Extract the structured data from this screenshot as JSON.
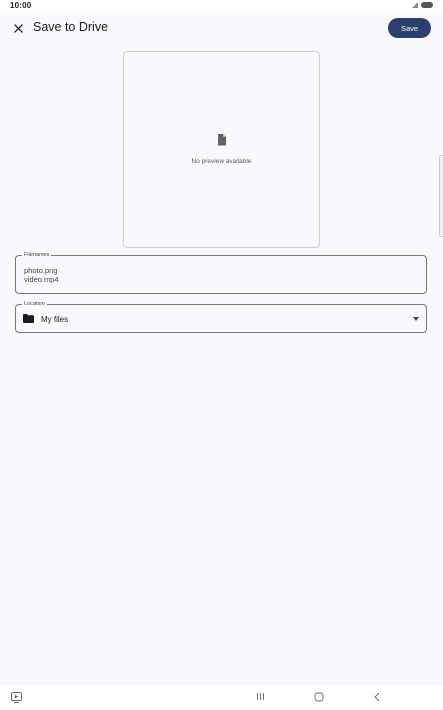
{
  "status_bar": {
    "time": "10:00"
  },
  "top_bar": {
    "title": "Save to Drive",
    "save_label": "Save"
  },
  "preview": {
    "message": "No preview available"
  },
  "filenames": {
    "label": "Filenames",
    "values": [
      "photo.png",
      "video.mp4"
    ]
  },
  "location": {
    "label": "Location",
    "value": "My files"
  },
  "colors": {
    "accent": "#2c3e6d",
    "background": "#f8f8fd",
    "outline": "#74777f"
  },
  "icons": {
    "close": "close-icon",
    "file": "file-icon",
    "folder": "folder-icon",
    "dropdown": "dropdown-arrow-icon",
    "nav_recents": "recent-apps-icon",
    "nav_home": "home-icon",
    "nav_back": "back-icon",
    "nav_left": "screen-capture-icon"
  }
}
